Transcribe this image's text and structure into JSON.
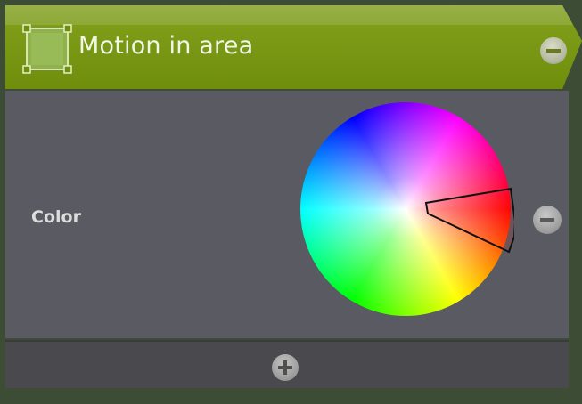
{
  "block": {
    "title": "Motion in area",
    "header_color": "#7a9a12",
    "icon": "area-selection-icon",
    "remove_icon": "minus-circle-icon"
  },
  "params": {
    "color": {
      "label": "Color",
      "selected_hue": "red",
      "remove_icon": "minus-circle-icon"
    }
  },
  "footer": {
    "add_icon": "plus-circle-icon"
  }
}
